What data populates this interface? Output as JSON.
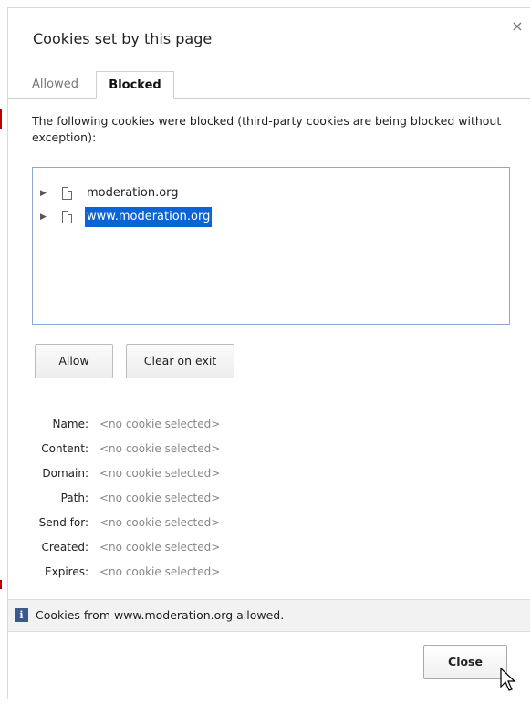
{
  "dialog": {
    "title": "Cookies set by this page",
    "close_glyph": "×"
  },
  "tabs": [
    {
      "label": "Allowed",
      "active": false
    },
    {
      "label": "Blocked",
      "active": true
    }
  ],
  "description": "The following cookies were blocked (third-party cookies are being blocked without exception):",
  "cookie_tree": [
    {
      "label": "moderation.org",
      "selected": false
    },
    {
      "label": "www.moderation.org",
      "selected": true
    }
  ],
  "buttons": {
    "allow": "Allow",
    "clear_on_exit": "Clear on exit",
    "close": "Close"
  },
  "details": [
    {
      "label": "Name:",
      "value": "<no cookie selected>"
    },
    {
      "label": "Content:",
      "value": "<no cookie selected>"
    },
    {
      "label": "Domain:",
      "value": "<no cookie selected>"
    },
    {
      "label": "Path:",
      "value": "<no cookie selected>"
    },
    {
      "label": "Send for:",
      "value": "<no cookie selected>"
    },
    {
      "label": "Created:",
      "value": "<no cookie selected>"
    },
    {
      "label": "Expires:",
      "value": "<no cookie selected>"
    }
  ],
  "infobar": {
    "icon": "info-icon",
    "icon_glyph": "i",
    "text": "Cookies from www.moderation.org allowed."
  },
  "colors": {
    "selection": "#0a64d6",
    "tree_border": "#8ca7d0",
    "info_icon": "#3a5a8c"
  }
}
